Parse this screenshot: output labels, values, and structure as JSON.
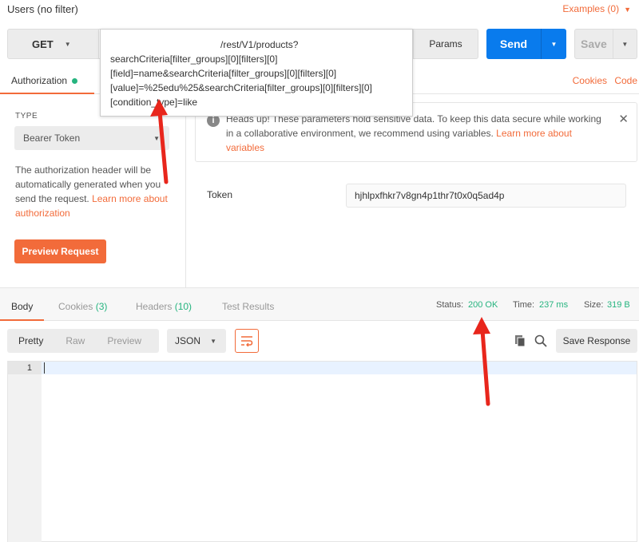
{
  "header": {
    "title": "Users (no filter)",
    "examples_label": "Examples (0)",
    "examples_caret": "▼"
  },
  "request": {
    "method": "GET",
    "params_label": "Params",
    "send_label": "Send",
    "save_label": "Save",
    "caret": "▼"
  },
  "url_tooltip": {
    "lines": [
      "/rest/V1/products?",
      "searchCriteria[filter_groups][0][filters][0]",
      "[field]=name&searchCriteria[filter_groups][0][filters][0]",
      "[value]=%25edu%25&searchCriteria[filter_groups][0][filters][0]",
      "[condition_type]=like"
    ]
  },
  "request_tabs": {
    "authorization": "Authorization",
    "cookies": "Cookies",
    "code": "Code"
  },
  "auth": {
    "type_label": "TYPE",
    "type_value": "Bearer Token",
    "desc_text": "The authorization header will be automatically generated when you send the request. ",
    "desc_link": "Learn more about authorization",
    "preview_button": "Preview Request",
    "notice_text": "Heads up! These parameters hold sensitive data. To keep this data secure while working in a collaborative environment, we recommend using variables. ",
    "notice_link": "Learn more about variables",
    "token_label": "Token",
    "token_value": "hjhlpxfhkr7v8gn4p1thr7t0x0q5ad4p"
  },
  "response_tabs": {
    "body": "Body",
    "cookies": "Cookies",
    "cookies_count": "(3)",
    "headers": "Headers",
    "headers_count": "(10)",
    "tests": "Test Results"
  },
  "response_meta": {
    "status_label": "Status:",
    "status_value": "200 OK",
    "time_label": "Time:",
    "time_value": "237 ms",
    "size_label": "Size:",
    "size_value": "319 B"
  },
  "view": {
    "pretty": "Pretty",
    "raw": "Raw",
    "preview": "Preview",
    "format": "JSON",
    "save_response": "Save Response"
  },
  "editor": {
    "line_number": "1"
  },
  "colors": {
    "accent": "#f26b3a",
    "send_blue": "#097bed",
    "status_green": "#26b47f",
    "annotation_red": "#e8261c"
  }
}
